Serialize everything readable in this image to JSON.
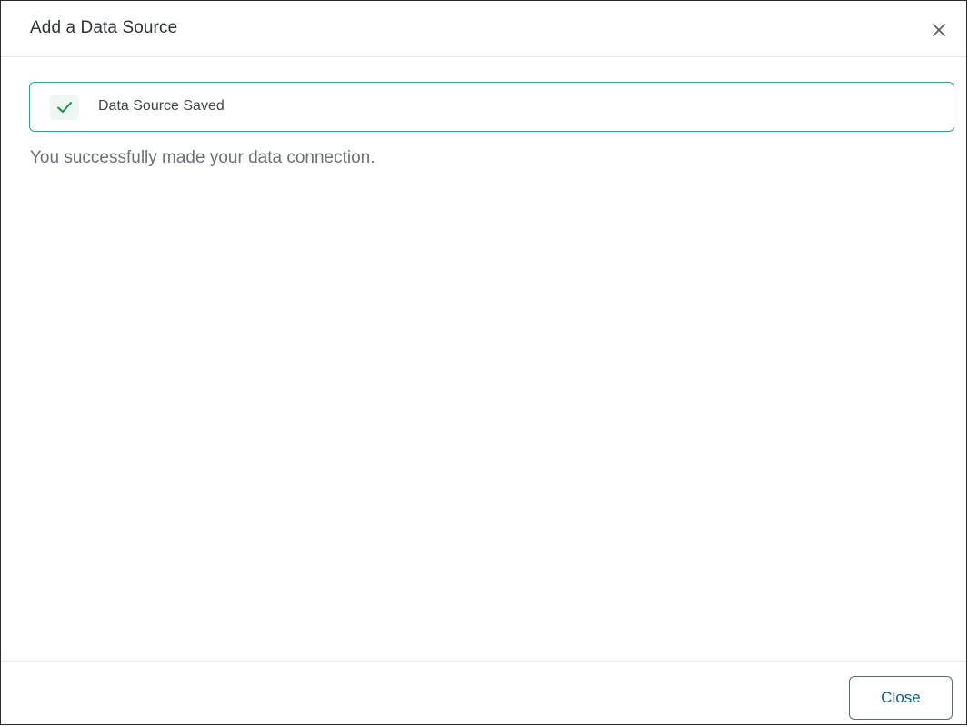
{
  "dialog": {
    "title": "Add a Data Source",
    "close_icon": "close-icon"
  },
  "banner": {
    "icon": "checkmark-icon",
    "text": "Data Source Saved",
    "border_color": "#3a9e83",
    "icon_color": "#1f8a4c"
  },
  "message": "You successfully made your data connection.",
  "footer": {
    "close_label": "Close"
  }
}
